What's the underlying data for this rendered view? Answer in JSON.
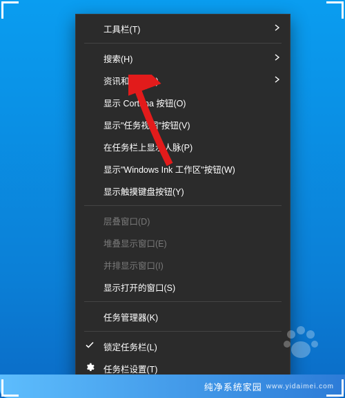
{
  "context_menu": {
    "items": [
      {
        "label": "工具栏(T)",
        "submenu": true
      },
      {
        "sep": true
      },
      {
        "label": "搜索(H)",
        "submenu": true
      },
      {
        "label": "资讯和兴趣(N)",
        "submenu": true,
        "highlight_arrow": true
      },
      {
        "label": "显示 Cortana 按钮(O)"
      },
      {
        "label": "显示\"任务视图\"按钮(V)"
      },
      {
        "label": "在任务栏上显示人脉(P)"
      },
      {
        "label": "显示\"Windows Ink 工作区\"按钮(W)"
      },
      {
        "label": "显示触摸键盘按钮(Y)"
      },
      {
        "sep": true
      },
      {
        "label": "层叠窗口(D)",
        "disabled": true
      },
      {
        "label": "堆叠显示窗口(E)",
        "disabled": true
      },
      {
        "label": "并排显示窗口(I)",
        "disabled": true
      },
      {
        "label": "显示打开的窗口(S)"
      },
      {
        "sep": true
      },
      {
        "label": "任务管理器(K)"
      },
      {
        "sep": true
      },
      {
        "label": "锁定任务栏(L)",
        "checked": true
      },
      {
        "label": "任务栏设置(T)",
        "icon": "gear"
      }
    ]
  },
  "watermark": {
    "title": "纯净系统家园",
    "subtitle": "www.yidaimei.com"
  }
}
